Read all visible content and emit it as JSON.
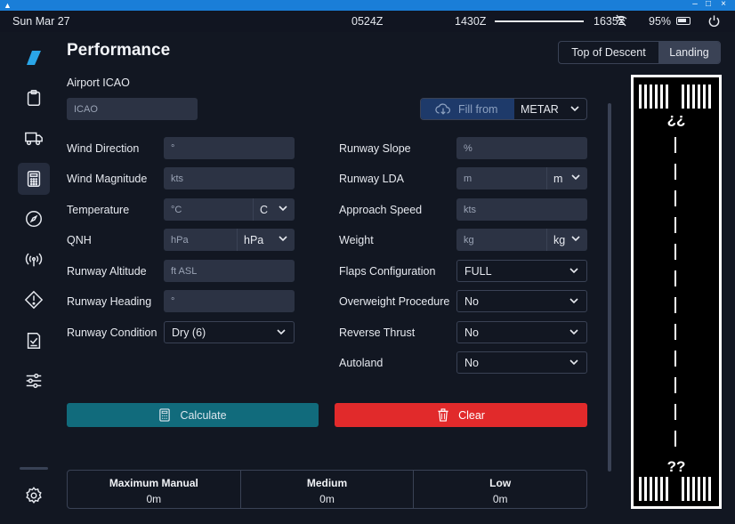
{
  "status": {
    "date": "Sun Mar 27",
    "zulu": "0524Z",
    "dep_time": "1430Z",
    "arr_time": "1635Z",
    "battery": "95%"
  },
  "sidebar": {
    "icons": [
      "app-logo-icon",
      "clipboard-icon",
      "truck-icon",
      "calculator-icon",
      "compass-icon",
      "antenna-icon",
      "warning-icon",
      "checklist-icon",
      "sliders-icon",
      "settings-icon"
    ],
    "active": "calculator-icon"
  },
  "page": {
    "title": "Performance",
    "tabs": [
      "Top of Descent",
      "Landing"
    ],
    "active_tab": "Landing"
  },
  "airport": {
    "label": "Airport ICAO",
    "placeholder": "ICAO",
    "fill_from_label": "Fill from",
    "fill_source": "METAR"
  },
  "left_fields": {
    "wind_direction": {
      "label": "Wind Direction",
      "placeholder": "°"
    },
    "wind_magnitude": {
      "label": "Wind Magnitude",
      "placeholder": "kts"
    },
    "temperature": {
      "label": "Temperature",
      "placeholder": "°C",
      "unit": "C"
    },
    "qnh": {
      "label": "QNH",
      "placeholder": "hPa",
      "unit": "hPa"
    },
    "runway_altitude": {
      "label": "Runway Altitude",
      "placeholder": "ft ASL"
    },
    "runway_heading": {
      "label": "Runway Heading",
      "placeholder": "°"
    },
    "runway_condition": {
      "label": "Runway Condition",
      "value": "Dry (6)"
    }
  },
  "right_fields": {
    "runway_slope": {
      "label": "Runway Slope",
      "placeholder": "%"
    },
    "runway_lda": {
      "label": "Runway LDA",
      "placeholder": "m",
      "unit": "m"
    },
    "approach_speed": {
      "label": "Approach Speed",
      "placeholder": "kts"
    },
    "weight": {
      "label": "Weight",
      "placeholder": "kg",
      "unit": "kg"
    },
    "flaps": {
      "label": "Flaps Configuration",
      "value": "FULL"
    },
    "overweight": {
      "label": "Overweight Procedure",
      "value": "No"
    },
    "reverse_thrust": {
      "label": "Reverse Thrust",
      "value": "No"
    },
    "autoland": {
      "label": "Autoland",
      "value": "No"
    }
  },
  "actions": {
    "calculate": "Calculate",
    "clear": "Clear"
  },
  "results": [
    {
      "label": "Maximum Manual",
      "value": "0m"
    },
    {
      "label": "Medium",
      "value": "0m"
    },
    {
      "label": "Low",
      "value": "0m"
    }
  ],
  "runway_diagram": {
    "top_label": "¿¿",
    "bottom_label": "??"
  }
}
